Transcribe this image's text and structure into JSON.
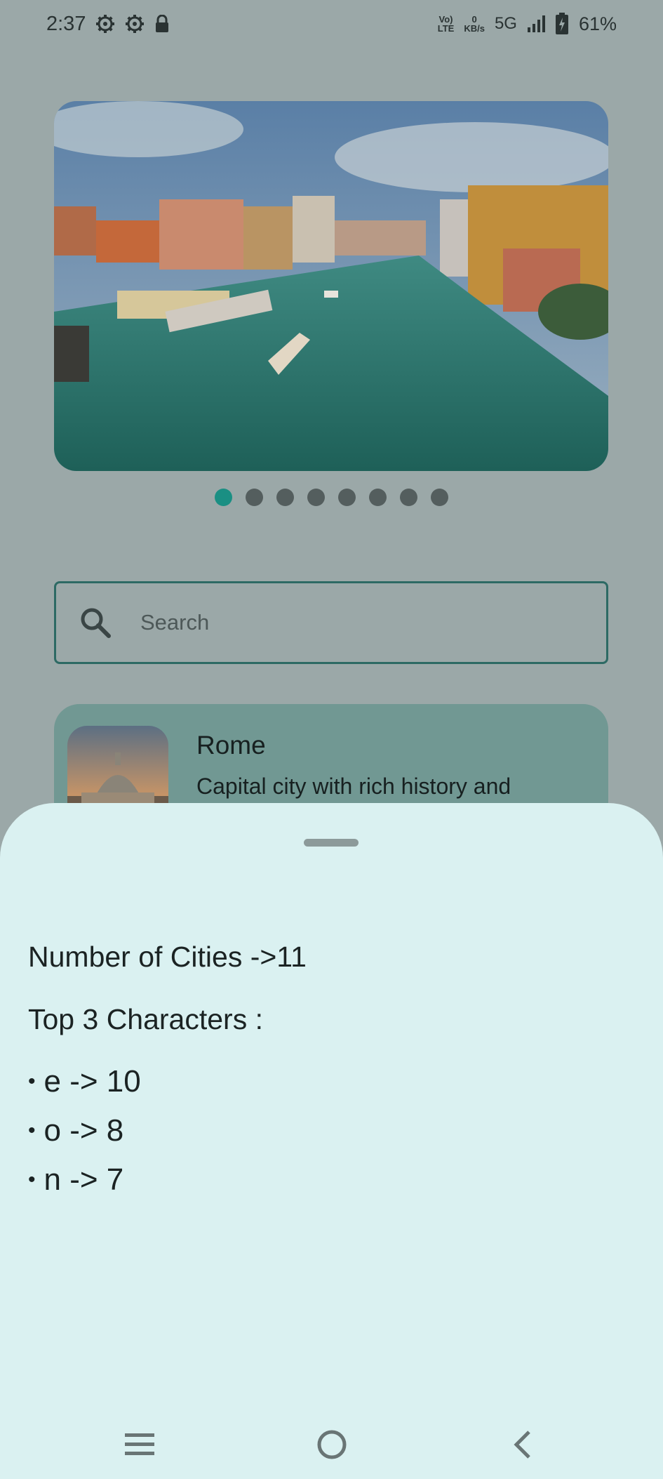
{
  "status_bar": {
    "time": "2:37",
    "left_icons": [
      "gear-icon",
      "gear-icon",
      "lock-icon"
    ],
    "network_top": "Vo)",
    "network_bottom": "LTE",
    "speed_value": "0",
    "speed_unit": "KB/s",
    "network_type": "5G",
    "battery_percent": "61%"
  },
  "carousel": {
    "image": "venice-grand-canal",
    "total_dots": 8,
    "active_index": 0,
    "active_color": "#1a8f83"
  },
  "search": {
    "placeholder": "Search",
    "value": ""
  },
  "city_card": {
    "name": "Rome",
    "description": "Capital city with rich history and architecture"
  },
  "bottom_sheet": {
    "cities_line": "Number of Cities ->11",
    "top_heading": "Top 3 Characters :",
    "bullet": "•",
    "top_characters": [
      {
        "text": "e -> 10"
      },
      {
        "text": "o -> 8"
      },
      {
        "text": "n -> 7"
      }
    ]
  },
  "nav_bar": {
    "buttons": [
      "menu-icon",
      "home-icon",
      "back-icon"
    ]
  },
  "colors": {
    "scrim_background": "#9ba8a8",
    "sheet_background": "#daf1f1",
    "card_background": "#719893",
    "search_border": "#2d6a64"
  }
}
